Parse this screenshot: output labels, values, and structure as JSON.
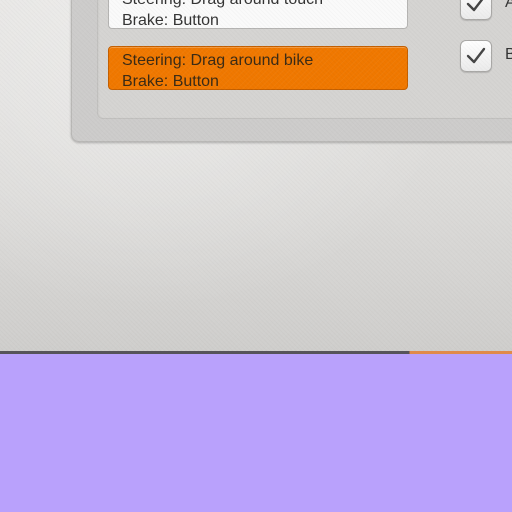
{
  "control_options": [
    {
      "id": "touch",
      "line1": "Steering: Drag around touch",
      "line2": "Brake: Button",
      "selected": false
    },
    {
      "id": "bike",
      "line1": "Steering: Drag around bike",
      "line2": "Brake: Button",
      "selected": true
    }
  ],
  "checkboxes": [
    {
      "label": "A",
      "checked": true
    },
    {
      "label": "B",
      "checked": true
    }
  ],
  "colors": {
    "selected_option": "#f07800",
    "lower_region": "#b9a1fc"
  }
}
